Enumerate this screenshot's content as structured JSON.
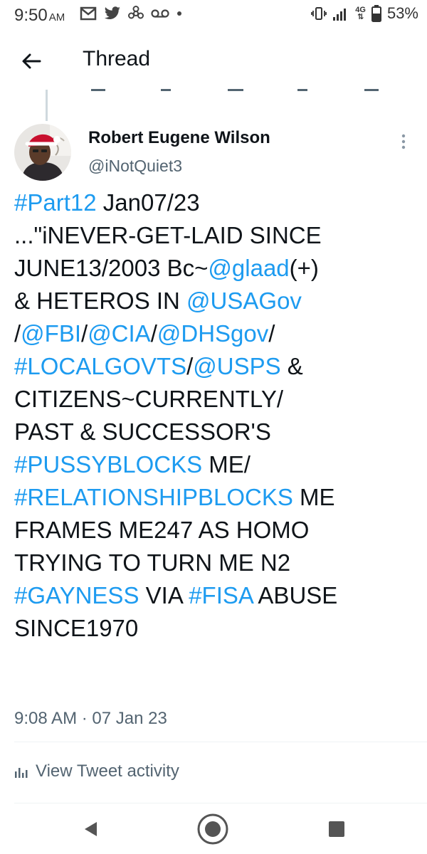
{
  "status_bar": {
    "time": "9:50",
    "ampm": "AM",
    "network": "4G",
    "battery": "53%",
    "left_icons": [
      "mail-icon",
      "twitter-bird-icon",
      "fan-icon",
      "voicemail-icon",
      "dot-icon"
    ],
    "right_icons": [
      "vibrate-icon",
      "signal-icon",
      "network-4g-icon",
      "battery-icon"
    ]
  },
  "header": {
    "title": "Thread"
  },
  "tweet": {
    "author_name": "Robert Eugene Wilson",
    "author_handle": "@iNotQuiet3",
    "lines": [
      [
        {
          "t": "#Part12",
          "link": true
        },
        {
          "t": " Jan07/23",
          "link": false
        }
      ],
      [
        {
          "t": "...\"iNEVER-GET-LAID SINCE",
          "link": false
        }
      ],
      [
        {
          "t": "JUNE13/2003 Bc~",
          "link": false
        },
        {
          "t": "@glaad",
          "link": true
        },
        {
          "t": "(+)",
          "link": false
        }
      ],
      [
        {
          "t": "& HETEROS IN ",
          "link": false
        },
        {
          "t": "@USAGov",
          "link": true
        }
      ],
      [
        {
          "t": "/",
          "link": false
        },
        {
          "t": "@FBI",
          "link": true
        },
        {
          "t": "/",
          "link": false
        },
        {
          "t": "@CIA",
          "link": true
        },
        {
          "t": "/",
          "link": false
        },
        {
          "t": "@DHSgov",
          "link": true
        },
        {
          "t": "/",
          "link": false
        }
      ],
      [
        {
          "t": "#LOCALGOVTS",
          "link": true
        },
        {
          "t": "/",
          "link": false
        },
        {
          "t": "@USPS",
          "link": true
        },
        {
          "t": " &",
          "link": false
        }
      ],
      [
        {
          "t": "CITIZENS~CURRENTLY/",
          "link": false
        }
      ],
      [
        {
          "t": "PAST & SUCCESSOR'S",
          "link": false
        }
      ],
      [
        {
          "t": "#PUSSYBLOCKS",
          "link": true
        },
        {
          "t": " ME/",
          "link": false
        }
      ],
      [
        {
          "t": "#RELATIONSHIPBLOCKS",
          "link": true
        },
        {
          "t": " ME",
          "link": false
        }
      ],
      [
        {
          "t": "FRAMES ME247 AS HOMO",
          "link": false
        }
      ],
      [
        {
          "t": "TRYING TO TURN ME N2",
          "link": false
        }
      ],
      [
        {
          "t": "#GAYNESS",
          "link": true
        },
        {
          "t": " VIA ",
          "link": false
        },
        {
          "t": "#FISA",
          "link": true
        },
        {
          "t": " ABUSE",
          "link": false
        }
      ],
      [
        {
          "t": "SINCE1970",
          "link": false
        }
      ]
    ],
    "timestamp": "9:08 AM · 07 Jan 23",
    "activity_label": "View Tweet activity"
  },
  "colors": {
    "link": "#1d9bf0",
    "text": "#0f1419",
    "secondary": "#536471"
  }
}
